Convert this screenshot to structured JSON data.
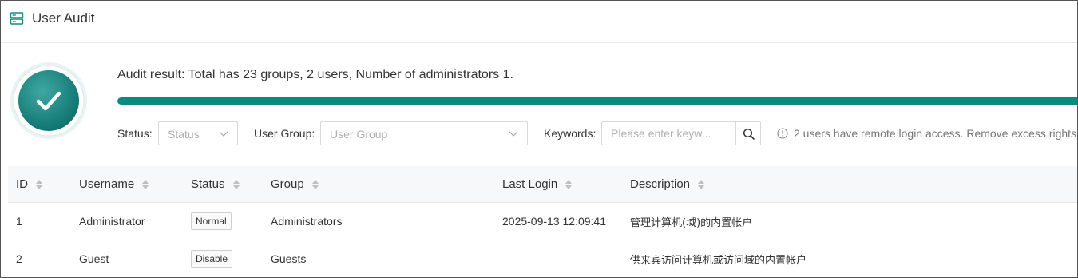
{
  "header": {
    "title": "User Audit",
    "icon": "server-icon"
  },
  "summary": {
    "text": "Audit result: Total has 23 groups, 2 users, Number of administrators 1.",
    "status_icon": "checkmark-icon",
    "progress_percent": 100,
    "accent_color": "#0e8a83"
  },
  "filters": {
    "status_label": "Status:",
    "status_placeholder": "Status",
    "group_label": "User Group:",
    "group_placeholder": "User Group",
    "keywords_label": "Keywords:",
    "keywords_placeholder": "Please enter keyw...",
    "notice": "2 users have remote login access. Remove excess rights."
  },
  "table": {
    "columns": [
      "ID",
      "Username",
      "Status",
      "Group",
      "Last Login",
      "Description"
    ],
    "rows": [
      {
        "id": "1",
        "username": "Administrator",
        "status": "Normal",
        "group": "Administrators",
        "last_login": "2025-09-13 12:09:41",
        "description": "管理计算机(域)的内置帐户"
      },
      {
        "id": "2",
        "username": "Guest",
        "status": "Disable",
        "group": "Guests",
        "last_login": "",
        "description": "供来宾访问计算机或访问域的内置帐户"
      }
    ]
  }
}
